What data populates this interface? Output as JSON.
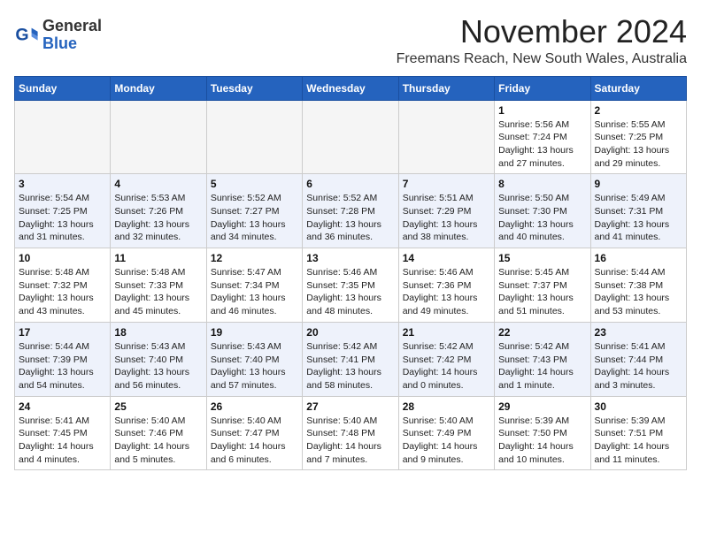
{
  "header": {
    "logo_general": "General",
    "logo_blue": "Blue",
    "month_title": "November 2024",
    "location": "Freemans Reach, New South Wales, Australia"
  },
  "weekdays": [
    "Sunday",
    "Monday",
    "Tuesday",
    "Wednesday",
    "Thursday",
    "Friday",
    "Saturday"
  ],
  "weeks": [
    [
      {
        "day": "",
        "info": ""
      },
      {
        "day": "",
        "info": ""
      },
      {
        "day": "",
        "info": ""
      },
      {
        "day": "",
        "info": ""
      },
      {
        "day": "",
        "info": ""
      },
      {
        "day": "1",
        "info": "Sunrise: 5:56 AM\nSunset: 7:24 PM\nDaylight: 13 hours and 27 minutes."
      },
      {
        "day": "2",
        "info": "Sunrise: 5:55 AM\nSunset: 7:25 PM\nDaylight: 13 hours and 29 minutes."
      }
    ],
    [
      {
        "day": "3",
        "info": "Sunrise: 5:54 AM\nSunset: 7:25 PM\nDaylight: 13 hours and 31 minutes."
      },
      {
        "day": "4",
        "info": "Sunrise: 5:53 AM\nSunset: 7:26 PM\nDaylight: 13 hours and 32 minutes."
      },
      {
        "day": "5",
        "info": "Sunrise: 5:52 AM\nSunset: 7:27 PM\nDaylight: 13 hours and 34 minutes."
      },
      {
        "day": "6",
        "info": "Sunrise: 5:52 AM\nSunset: 7:28 PM\nDaylight: 13 hours and 36 minutes."
      },
      {
        "day": "7",
        "info": "Sunrise: 5:51 AM\nSunset: 7:29 PM\nDaylight: 13 hours and 38 minutes."
      },
      {
        "day": "8",
        "info": "Sunrise: 5:50 AM\nSunset: 7:30 PM\nDaylight: 13 hours and 40 minutes."
      },
      {
        "day": "9",
        "info": "Sunrise: 5:49 AM\nSunset: 7:31 PM\nDaylight: 13 hours and 41 minutes."
      }
    ],
    [
      {
        "day": "10",
        "info": "Sunrise: 5:48 AM\nSunset: 7:32 PM\nDaylight: 13 hours and 43 minutes."
      },
      {
        "day": "11",
        "info": "Sunrise: 5:48 AM\nSunset: 7:33 PM\nDaylight: 13 hours and 45 minutes."
      },
      {
        "day": "12",
        "info": "Sunrise: 5:47 AM\nSunset: 7:34 PM\nDaylight: 13 hours and 46 minutes."
      },
      {
        "day": "13",
        "info": "Sunrise: 5:46 AM\nSunset: 7:35 PM\nDaylight: 13 hours and 48 minutes."
      },
      {
        "day": "14",
        "info": "Sunrise: 5:46 AM\nSunset: 7:36 PM\nDaylight: 13 hours and 49 minutes."
      },
      {
        "day": "15",
        "info": "Sunrise: 5:45 AM\nSunset: 7:37 PM\nDaylight: 13 hours and 51 minutes."
      },
      {
        "day": "16",
        "info": "Sunrise: 5:44 AM\nSunset: 7:38 PM\nDaylight: 13 hours and 53 minutes."
      }
    ],
    [
      {
        "day": "17",
        "info": "Sunrise: 5:44 AM\nSunset: 7:39 PM\nDaylight: 13 hours and 54 minutes."
      },
      {
        "day": "18",
        "info": "Sunrise: 5:43 AM\nSunset: 7:40 PM\nDaylight: 13 hours and 56 minutes."
      },
      {
        "day": "19",
        "info": "Sunrise: 5:43 AM\nSunset: 7:40 PM\nDaylight: 13 hours and 57 minutes."
      },
      {
        "day": "20",
        "info": "Sunrise: 5:42 AM\nSunset: 7:41 PM\nDaylight: 13 hours and 58 minutes."
      },
      {
        "day": "21",
        "info": "Sunrise: 5:42 AM\nSunset: 7:42 PM\nDaylight: 14 hours and 0 minutes."
      },
      {
        "day": "22",
        "info": "Sunrise: 5:42 AM\nSunset: 7:43 PM\nDaylight: 14 hours and 1 minute."
      },
      {
        "day": "23",
        "info": "Sunrise: 5:41 AM\nSunset: 7:44 PM\nDaylight: 14 hours and 3 minutes."
      }
    ],
    [
      {
        "day": "24",
        "info": "Sunrise: 5:41 AM\nSunset: 7:45 PM\nDaylight: 14 hours and 4 minutes."
      },
      {
        "day": "25",
        "info": "Sunrise: 5:40 AM\nSunset: 7:46 PM\nDaylight: 14 hours and 5 minutes."
      },
      {
        "day": "26",
        "info": "Sunrise: 5:40 AM\nSunset: 7:47 PM\nDaylight: 14 hours and 6 minutes."
      },
      {
        "day": "27",
        "info": "Sunrise: 5:40 AM\nSunset: 7:48 PM\nDaylight: 14 hours and 7 minutes."
      },
      {
        "day": "28",
        "info": "Sunrise: 5:40 AM\nSunset: 7:49 PM\nDaylight: 14 hours and 9 minutes."
      },
      {
        "day": "29",
        "info": "Sunrise: 5:39 AM\nSunset: 7:50 PM\nDaylight: 14 hours and 10 minutes."
      },
      {
        "day": "30",
        "info": "Sunrise: 5:39 AM\nSunset: 7:51 PM\nDaylight: 14 hours and 11 minutes."
      }
    ]
  ]
}
